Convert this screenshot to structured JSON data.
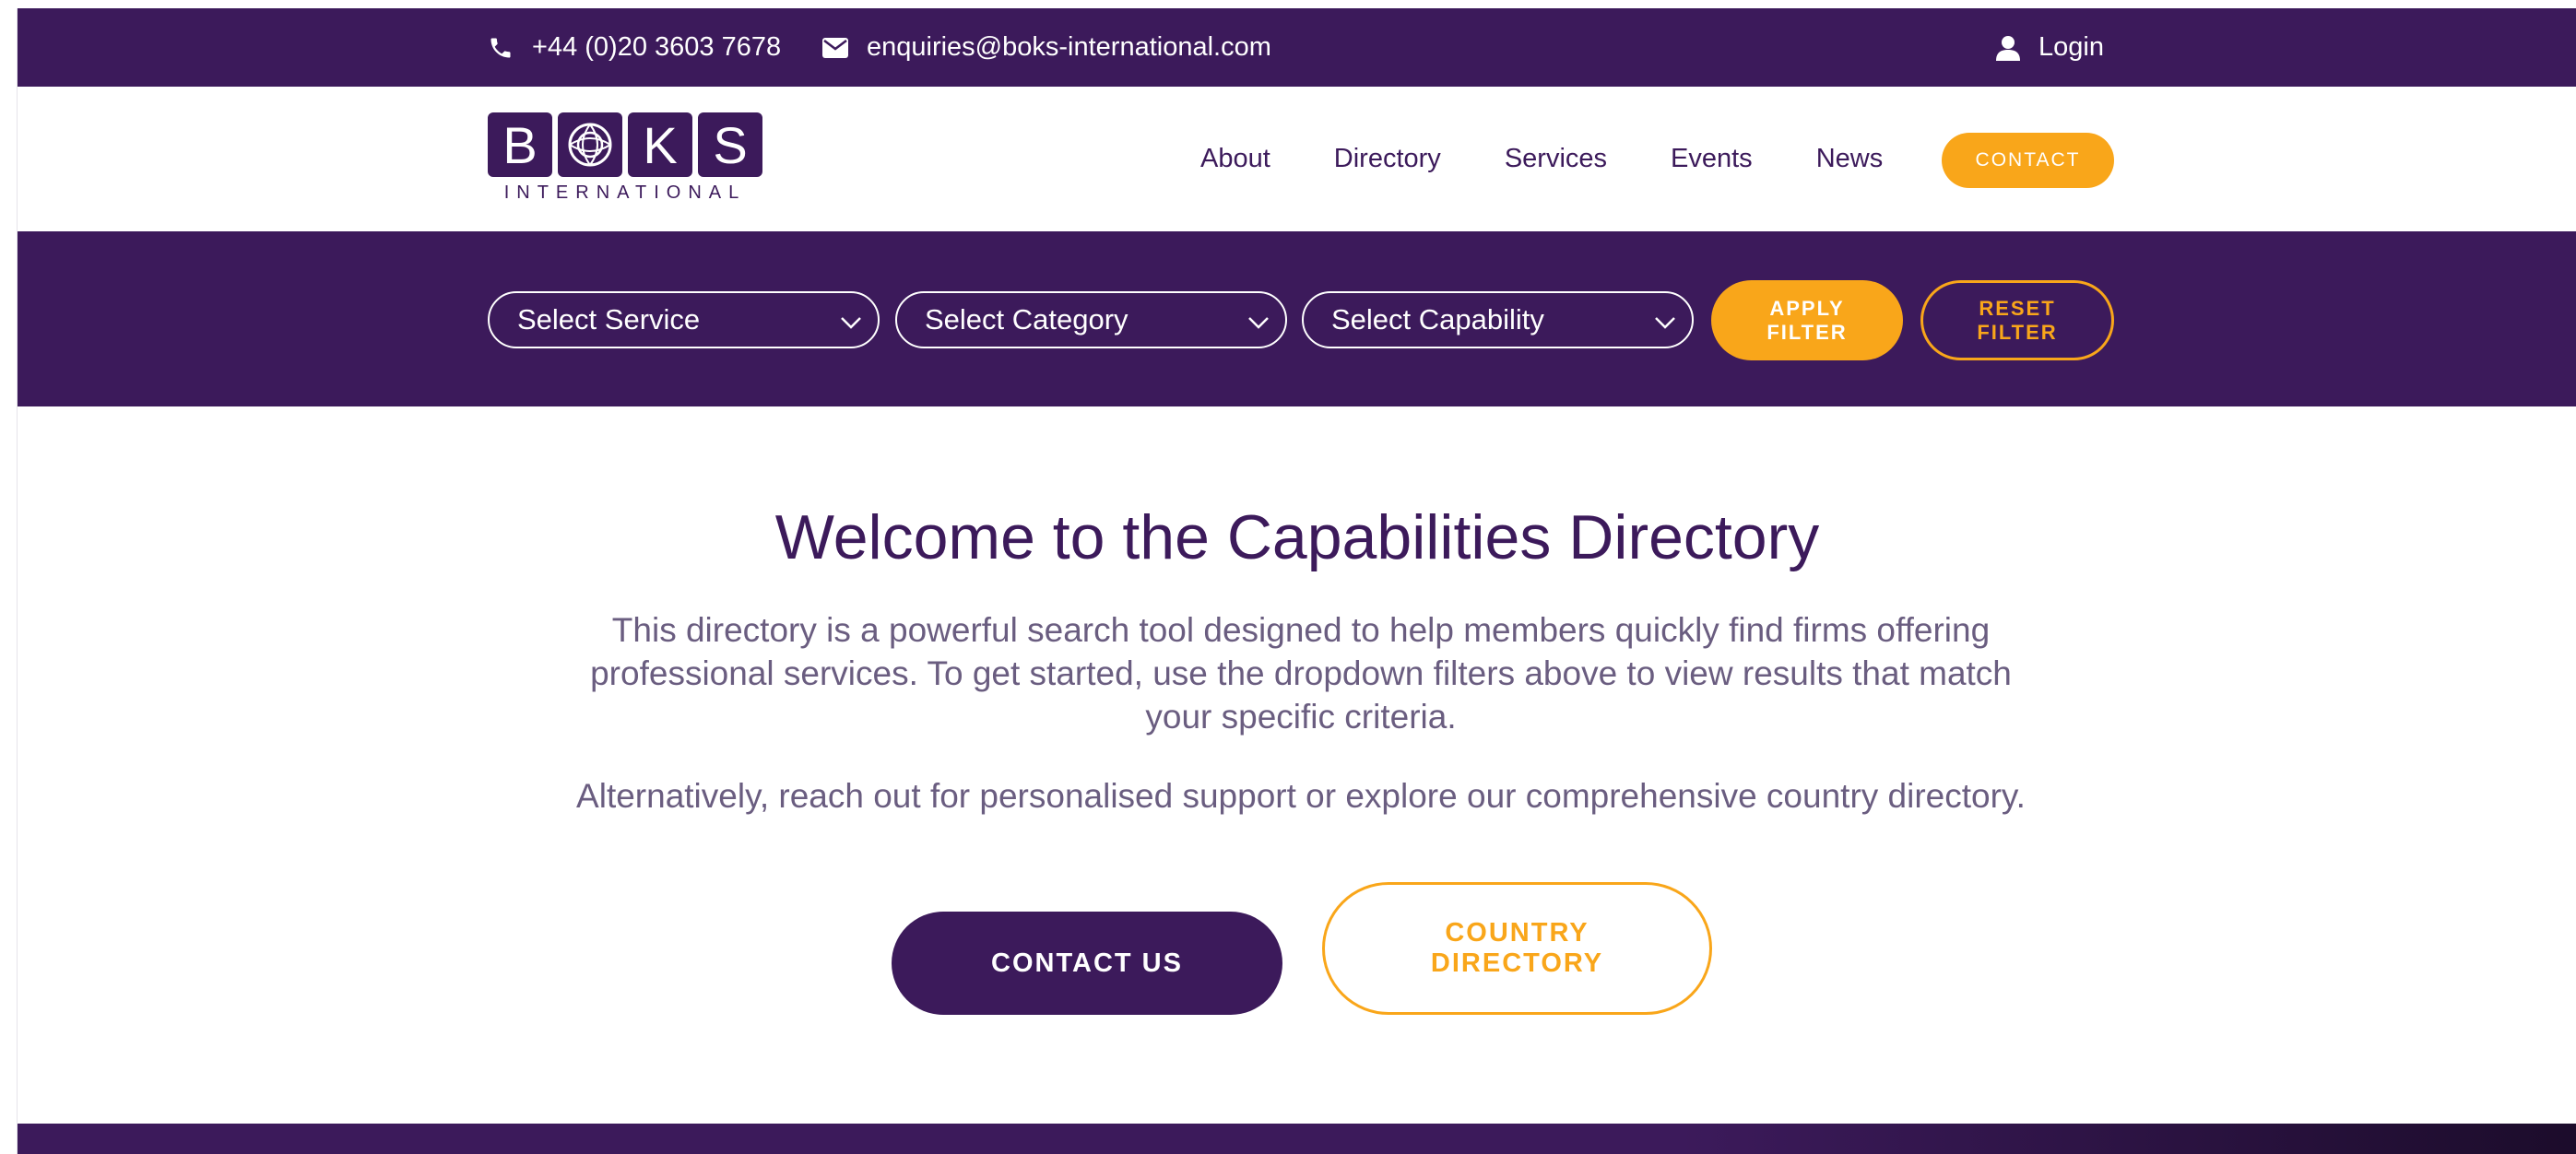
{
  "topbar": {
    "phone": "+44 (0)20 3603 7678",
    "email": "enquiries@boks-international.com",
    "login": "Login"
  },
  "logo": {
    "letters": [
      "B",
      "",
      "K",
      "S"
    ],
    "subtitle": "INTERNATIONAL"
  },
  "nav": {
    "items": [
      {
        "label": "About"
      },
      {
        "label": "Directory"
      },
      {
        "label": "Services"
      },
      {
        "label": "Events"
      },
      {
        "label": "News"
      }
    ],
    "contact_label": "CONTACT"
  },
  "filters": {
    "service": "Select Service",
    "category": "Select Category",
    "capability": "Select Capability",
    "apply_line1": "APPLY",
    "apply_line2": "FILTER",
    "reset_line1": "RESET",
    "reset_line2": "FILTER"
  },
  "main": {
    "title": "Welcome to the Capabilities Directory",
    "intro_line1": "This directory is a powerful search tool designed to help members quickly find firms offering",
    "intro_line2": "professional services. To get started, use the dropdown filters above to view results that match",
    "intro_line3": "your specific criteria.",
    "alternative": "Alternatively, reach out for personalised support or explore our comprehensive country directory.",
    "contact_us": "CONTACT US",
    "country_line1": "COUNTRY",
    "country_line2": "DIRECTORY"
  },
  "colors": {
    "brand_purple": "#3c1a5b",
    "accent_orange": "#f9a61a",
    "body_text": "#6a5d80"
  },
  "icons": {
    "phone": "phone-icon",
    "mail": "envelope-icon",
    "user": "user-icon",
    "chevron": "chevron-down-icon",
    "logo_globe": "globe-icon"
  }
}
